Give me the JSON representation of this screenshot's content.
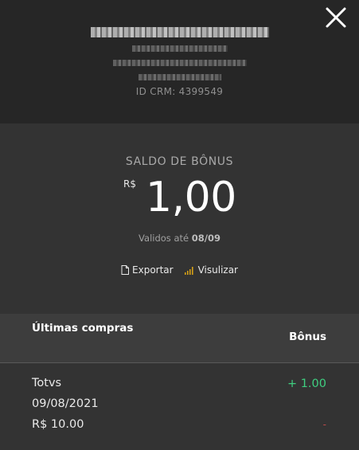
{
  "header": {
    "crm_id": "ID CRM: 4399549",
    "close_icon": "close-icon"
  },
  "balance": {
    "label": "SALDO DE BÔNUS",
    "currency": "R$",
    "amount": "1,00",
    "validity_prefix": "Validos até",
    "validity_date": "08/09",
    "export_label": "Exportar",
    "export_icon": "document-icon",
    "view_label": "Visulizar",
    "view_icon": "bar-chart-icon"
  },
  "purchases": {
    "title": "Últimas compras",
    "bonus_header": "Bônus",
    "items": [
      {
        "store": "Totvs",
        "date": "09/08/2021",
        "value": "R$ 10.00",
        "bonus": "+ 1.00",
        "debit": "-"
      }
    ]
  },
  "colors": {
    "background_dark": "#262626",
    "panel": "#333333",
    "table_header": "#3d3d3d",
    "bonus_positive": "#3fcf80",
    "debit": "#c04a4a"
  }
}
